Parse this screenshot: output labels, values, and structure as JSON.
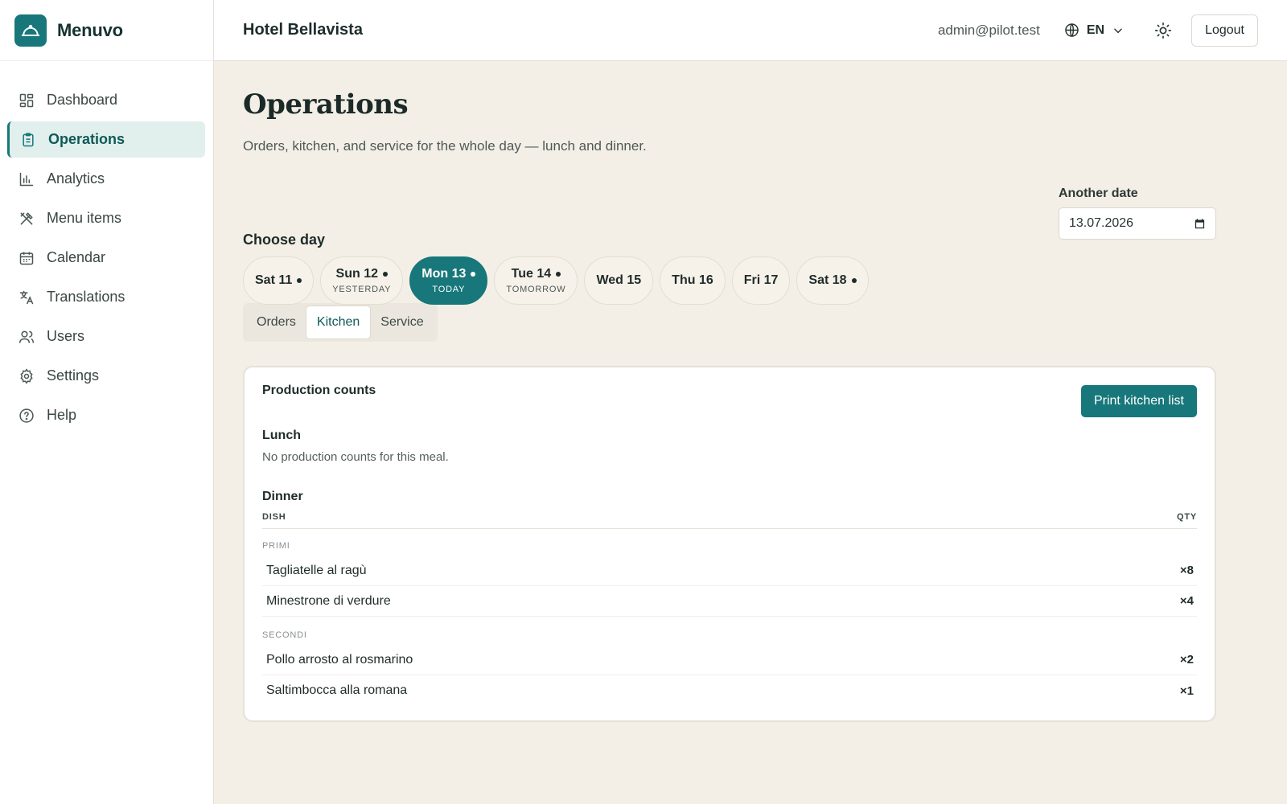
{
  "brand": {
    "name": "Menuvo"
  },
  "sidebar": {
    "items": [
      {
        "label": "Dashboard",
        "icon": "dashboard-icon"
      },
      {
        "label": "Operations",
        "icon": "clipboard-icon",
        "active": true
      },
      {
        "label": "Analytics",
        "icon": "bar-chart-icon"
      },
      {
        "label": "Menu items",
        "icon": "utensils-icon"
      },
      {
        "label": "Calendar",
        "icon": "calendar-icon"
      },
      {
        "label": "Translations",
        "icon": "translate-icon"
      },
      {
        "label": "Users",
        "icon": "users-icon"
      },
      {
        "label": "Settings",
        "icon": "gear-icon"
      },
      {
        "label": "Help",
        "icon": "help-icon"
      }
    ]
  },
  "header": {
    "hotel": "Hotel Bellavista",
    "email": "admin@pilot.test",
    "language": "EN",
    "logout": "Logout"
  },
  "page": {
    "title": "Operations",
    "subtitle": "Orders, kitchen, and service for the whole day — lunch and dinner.",
    "choose_day": "Choose day",
    "another_date_label": "Another date",
    "date_value": "13.07.2026"
  },
  "days": [
    {
      "label": "Sat 11",
      "dot": true,
      "sub": ""
    },
    {
      "label": "Sun 12",
      "dot": true,
      "sub": "YESTERDAY"
    },
    {
      "label": "Mon 13",
      "dot": true,
      "sub": "TODAY",
      "active": true
    },
    {
      "label": "Tue 14",
      "dot": true,
      "sub": "TOMORROW"
    },
    {
      "label": "Wed 15",
      "dot": false,
      "sub": ""
    },
    {
      "label": "Thu 16",
      "dot": false,
      "sub": ""
    },
    {
      "label": "Fri 17",
      "dot": false,
      "sub": ""
    },
    {
      "label": "Sat 18",
      "dot": true,
      "sub": ""
    }
  ],
  "tabs": [
    {
      "label": "Orders"
    },
    {
      "label": "Kitchen",
      "active": true
    },
    {
      "label": "Service"
    }
  ],
  "card": {
    "title": "Production counts",
    "print_button": "Print kitchen list",
    "lunch": {
      "title": "Lunch",
      "empty": "No production counts for this meal."
    },
    "dinner": {
      "title": "Dinner",
      "col_dish": "DISH",
      "col_qty": "QTY",
      "categories": [
        {
          "name": "PRIMI",
          "rows": [
            {
              "dish": "Tagliatelle al ragù",
              "qty": "×8"
            },
            {
              "dish": "Minestrone di verdure",
              "qty": "×4"
            }
          ]
        },
        {
          "name": "SECONDI",
          "rows": [
            {
              "dish": "Pollo arrosto al rosmarino",
              "qty": "×2"
            },
            {
              "dish": "Saltimbocca alla romana",
              "qty": "×1"
            }
          ]
        }
      ]
    }
  },
  "colors": {
    "accent": "#17777a",
    "background": "#f3efe6"
  }
}
